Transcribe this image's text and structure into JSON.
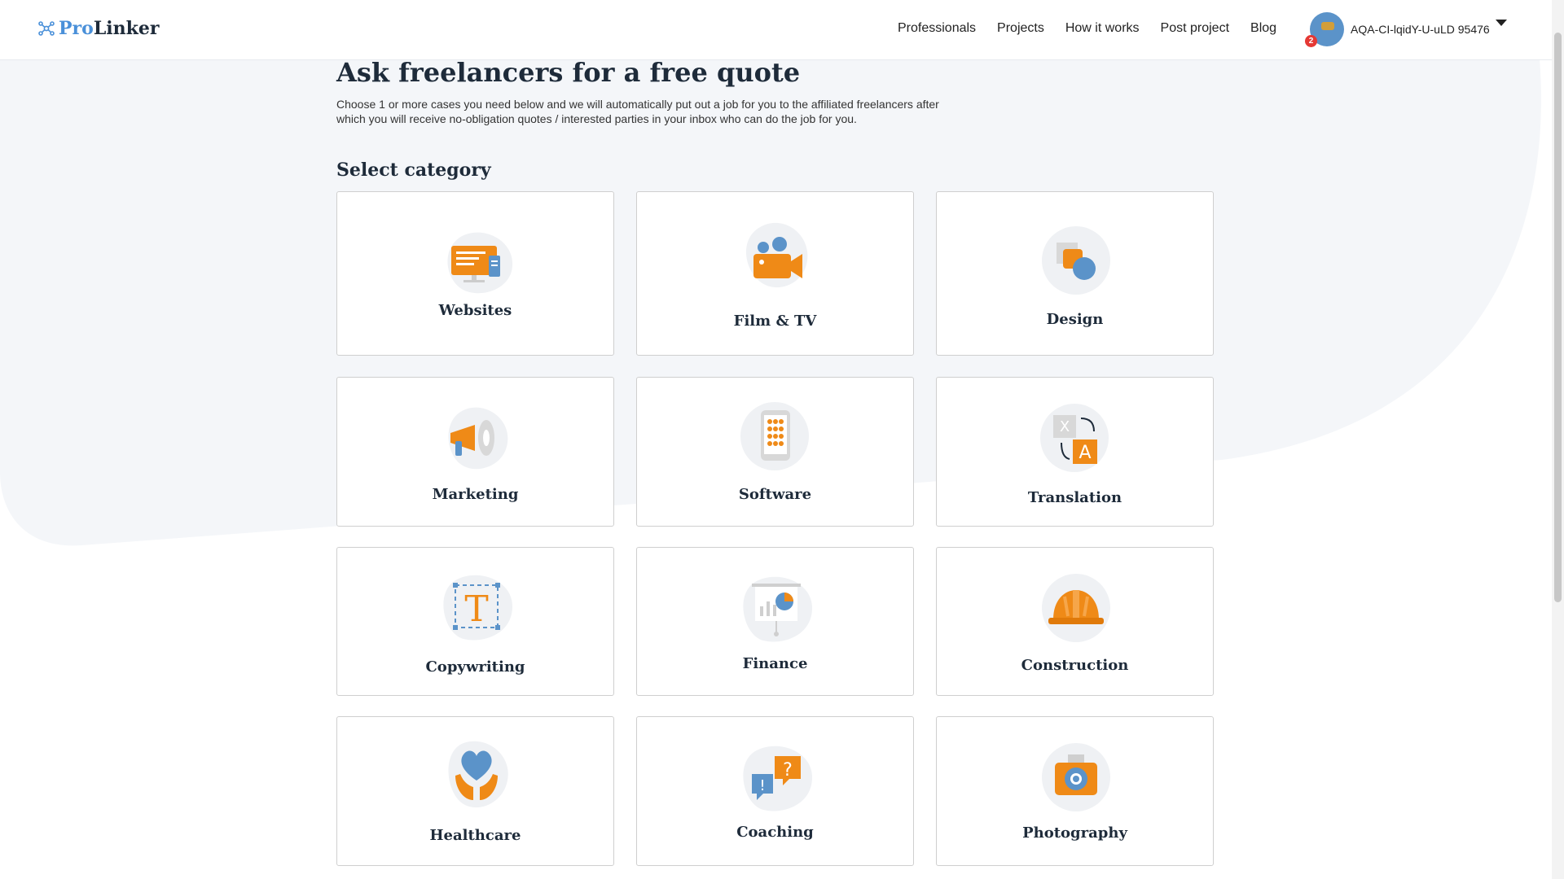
{
  "brand": {
    "name_part1": "Pro",
    "name_part2": "Linker"
  },
  "nav": {
    "links": [
      "Professionals",
      "Projects",
      "How it works",
      "Post project",
      "Blog"
    ]
  },
  "user": {
    "name": "AQA-CI-lqidY-U-uLD 95476",
    "notification_count": "2"
  },
  "main": {
    "title": "Ask freelancers for a free quote",
    "description": "Choose 1 or more cases you need below and we will automatically put out a job for you to the affiliated freelancers after which you will receive no-obligation quotes / interested parties in your inbox who can do the job for you.",
    "section_title": "Select category"
  },
  "categories": [
    {
      "label": "Websites",
      "icon": "websites-icon"
    },
    {
      "label": "Film & TV",
      "icon": "film-tv-icon"
    },
    {
      "label": "Design",
      "icon": "design-icon"
    },
    {
      "label": "Marketing",
      "icon": "marketing-icon"
    },
    {
      "label": "Software",
      "icon": "software-icon"
    },
    {
      "label": "Translation",
      "icon": "translation-icon"
    },
    {
      "label": "Copywriting",
      "icon": "copywriting-icon"
    },
    {
      "label": "Finance",
      "icon": "finance-icon"
    },
    {
      "label": "Construction",
      "icon": "construction-icon"
    },
    {
      "label": "Healthcare",
      "icon": "healthcare-icon"
    },
    {
      "label": "Coaching",
      "icon": "coaching-icon"
    },
    {
      "label": "Photography",
      "icon": "photography-icon"
    }
  ],
  "colors": {
    "accent_orange": "#ef8a17",
    "accent_blue": "#4a90d9",
    "heading": "#1e2b3a",
    "swoosh": "#f4f6f9"
  }
}
